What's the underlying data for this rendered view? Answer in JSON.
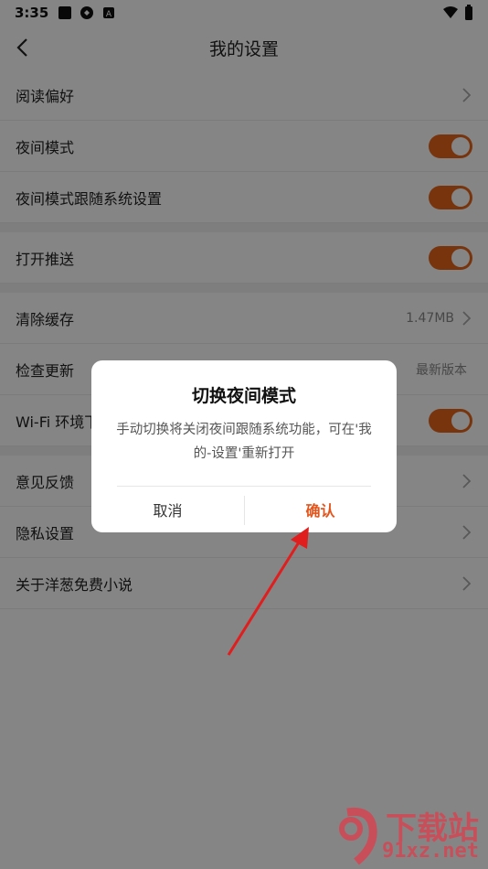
{
  "status_bar": {
    "time": "3:35"
  },
  "header": {
    "title": "我的设置"
  },
  "settings": {
    "reading_pref": "阅读偏好",
    "night_mode": "夜间模式",
    "night_follow_system": "夜间模式跟随系统设置",
    "push": "打开推送",
    "clear_cache": "清除缓存",
    "cache_size": "1.47MB",
    "check_update": "检查更新",
    "update_status": "最新版本",
    "wifi": "Wi-Fi 环境下",
    "feedback": "意见反馈",
    "privacy": "隐私设置",
    "about": "关于洋葱免费小说"
  },
  "dialog": {
    "title": "切换夜间模式",
    "message": "手动切换将关闭夜间跟随系统功能，可在'我的-设置'重新打开",
    "cancel": "取消",
    "confirm": "确认"
  },
  "watermark": {
    "brand": "下载站",
    "domain": "91xz.net"
  },
  "colors": {
    "accent": "#e4651a",
    "confirm": "#e2561e",
    "arrow": "#e01e1e"
  }
}
